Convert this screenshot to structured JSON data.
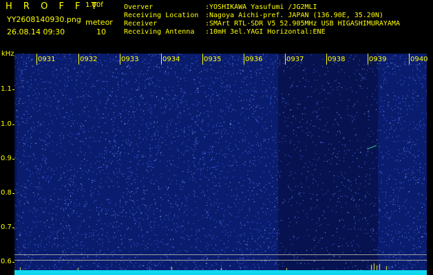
{
  "header": {
    "app_title": "H R O F F T",
    "version": "1.00f",
    "filename": "YY2608140930.png",
    "datetime": "26.08.14 09:30",
    "meteor_label": "meteor",
    "meteor_count": "10"
  },
  "info": [
    {
      "label": "Overver",
      "value": ":YOSHIKAWA Yasufumi /JG2MLI"
    },
    {
      "label": "Receiving Location",
      "value": ":Nagoya Aichi-pref. JAPAN (136.90E, 35.20N)"
    },
    {
      "label": "Receiver",
      "value": ":SMArt RTL-SDR V5 52.905MHz USB HIGASHIMURAYAMA"
    },
    {
      "label": "Receiving Antenna",
      "value": ":10mH 3el.YAGI Horizontal:ENE"
    }
  ],
  "spectrogram": {
    "y_unit": "kHz",
    "y_ticks": [
      "1.1",
      "1.0",
      "0.9",
      "0.8",
      "0.7",
      "0.6"
    ],
    "y_range": [
      0.58,
      1.18
    ],
    "time_labels": [
      "0931",
      "0932",
      "0933",
      "0934",
      "0935",
      "0936",
      "0937",
      "0938",
      "0939",
      "0940"
    ],
    "colors": {
      "background": "#0a1c6e",
      "dark_background": "#071250",
      "noise_dot": "#4a78ff",
      "bright_dot": "#9fd0ff",
      "trace": "#40e0a0",
      "baseline": "#10d8f0",
      "spike": "#ffff30",
      "grid": "#a0a0a0",
      "label": "#ffff00"
    }
  }
}
